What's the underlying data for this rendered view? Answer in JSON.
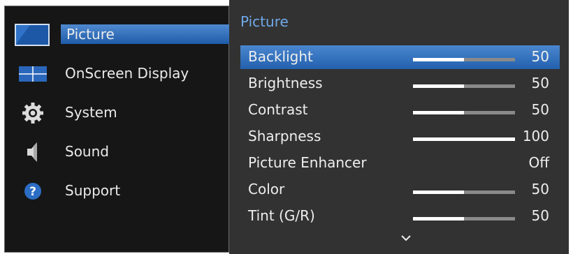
{
  "left_menu": {
    "items": [
      {
        "label": "Picture",
        "icon": "picture-icon"
      },
      {
        "label": "OnScreen Display",
        "icon": "onscreen-display-icon"
      },
      {
        "label": "System",
        "icon": "gear-icon"
      },
      {
        "label": "Sound",
        "icon": "speaker-icon"
      },
      {
        "label": "Support",
        "icon": "question-icon"
      }
    ],
    "selected_index": 0
  },
  "right_panel": {
    "title": "Picture",
    "rows": [
      {
        "label": "Backlight",
        "value": "50",
        "level": 0.5
      },
      {
        "label": "Brightness",
        "value": "50",
        "level": 0.5
      },
      {
        "label": "Contrast",
        "value": "50",
        "level": 0.5
      },
      {
        "label": "Sharpness",
        "value": "100",
        "level": 1.0
      },
      {
        "label": "Picture Enhancer",
        "value": "Off"
      },
      {
        "label": "Color",
        "value": "50",
        "level": 0.5
      },
      {
        "label": "Tint (G/R)",
        "value": "50",
        "level": 0.5
      }
    ],
    "selected_index": 0,
    "more_indicator": "chevron-down-icon"
  },
  "colors": {
    "accent": "#70a9ea",
    "selection": "#2f6db8",
    "panel_bg": "#323232",
    "menu_bg": "#161616"
  }
}
